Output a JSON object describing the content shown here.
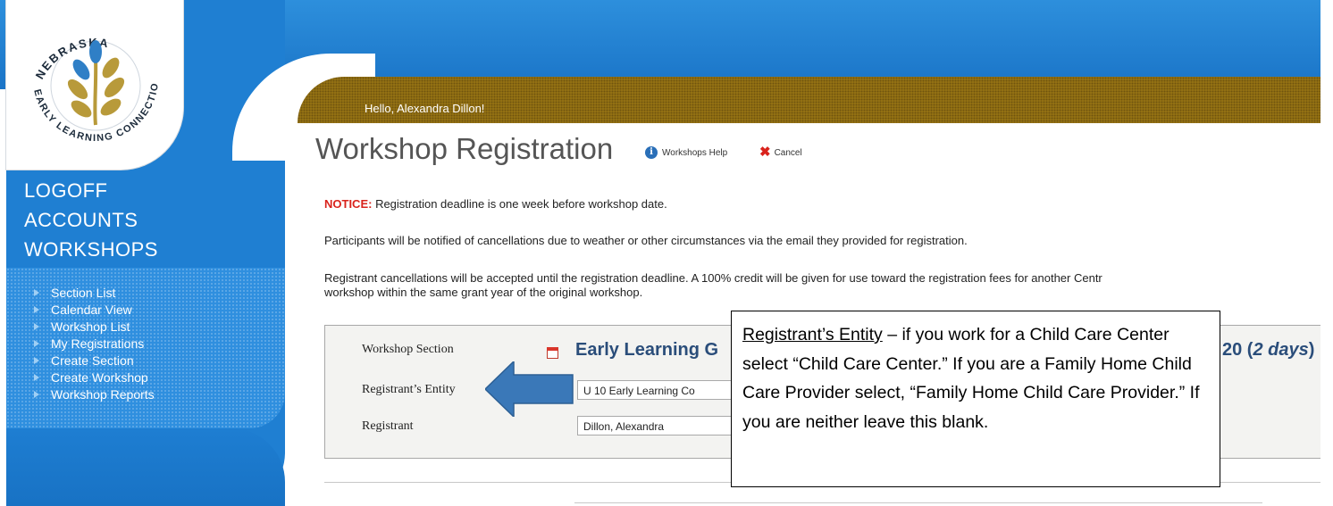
{
  "logo": {
    "text_top": "NEBRASKA",
    "text_bottom": "EARLY LEARNING CONNECTION",
    "icon": "leaf-plant-icon"
  },
  "header": {
    "greeting": "Hello, Alexandra Dillon!"
  },
  "nav": {
    "main": [
      "LOGOFF",
      "ACCOUNTS",
      "WORKSHOPS"
    ],
    "sub": [
      "Section List",
      "Calendar View",
      "Workshop List",
      "My Registrations",
      "Create Section",
      "Create Workshop",
      "Workshop Reports"
    ]
  },
  "page": {
    "title": "Workshop Registration",
    "help_label": "Workshops Help",
    "cancel_label": "Cancel",
    "notice_label": "NOTICE:",
    "notice_text": " Registration deadline is one week before workshop date.",
    "para1": "Participants will be notified of cancellations due to weather or other circumstances via the email they provided for registration.",
    "para2_line1": "Registrant cancellations will be accepted until the registration deadline. A 100% credit will be given for use toward the registration fees for another Centr",
    "para2_line2": "workshop within the same grant year of the original workshop."
  },
  "form": {
    "section_label": "Workshop Section",
    "entity_label": "Registrant’s Entity",
    "registrant_label": "Registrant",
    "workshop_name": "Early Learning G",
    "workshop_dates_num": "20 (",
    "workshop_dates_em": "2 days",
    "workshop_dates_end": ")",
    "entity_value": "U 10 Early Learning Co",
    "registrant_value": "Dillon, Alexandra"
  },
  "annotation": {
    "heading": "Registrant’s Entity",
    "body": " – if you work for a Child Care Center select “Child Care Center.”  If you are a Family Home Child Care Provider select, “Family Home Child Care Provider.” If you are neither leave this blank."
  },
  "colors": {
    "brand_blue": "#1f7fd2",
    "gold": "#9a7514",
    "title_navy": "#2a4d7a",
    "notice_red": "#d9231c",
    "arrow_blue": "#3a78b8"
  }
}
